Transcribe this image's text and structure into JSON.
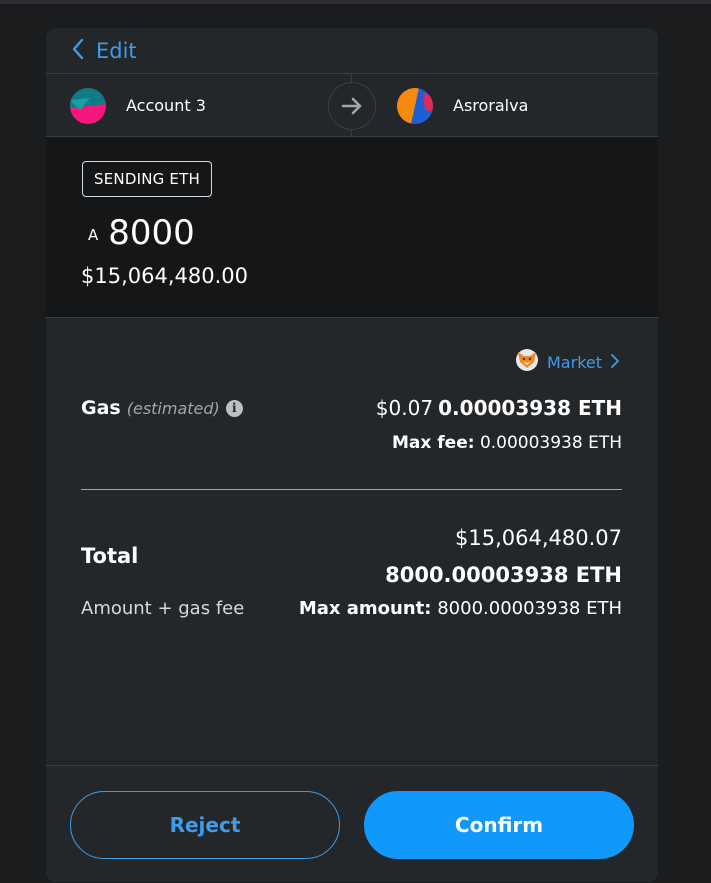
{
  "header": {
    "back_label": "Edit"
  },
  "accounts": {
    "from_name": "Account 3",
    "to_name": "Asroralva"
  },
  "sending": {
    "badge": "SENDING ETH",
    "currency_symbol": "A",
    "amount": "8000",
    "fiat": "$15,064,480.00"
  },
  "gas": {
    "market_label": "Market",
    "label": "Gas",
    "estimated": "(estimated)",
    "fiat": "$0.07",
    "eth": "0.00003938 ETH",
    "max_fee_label": "Max fee:",
    "max_fee_value": "0.00003938 ETH"
  },
  "total": {
    "label": "Total",
    "fiat": "$15,064,480.07",
    "eth": "8000.00003938 ETH",
    "subtitle": "Amount + gas fee",
    "max_amount_label": "Max amount:",
    "max_amount_value": "8000.00003938 ETH"
  },
  "footer": {
    "reject_label": "Reject",
    "confirm_label": "Confirm"
  },
  "colors": {
    "accent": "#3d9ded",
    "confirm": "#1098fc",
    "panel": "#24272a",
    "sending_bg": "#141618"
  }
}
